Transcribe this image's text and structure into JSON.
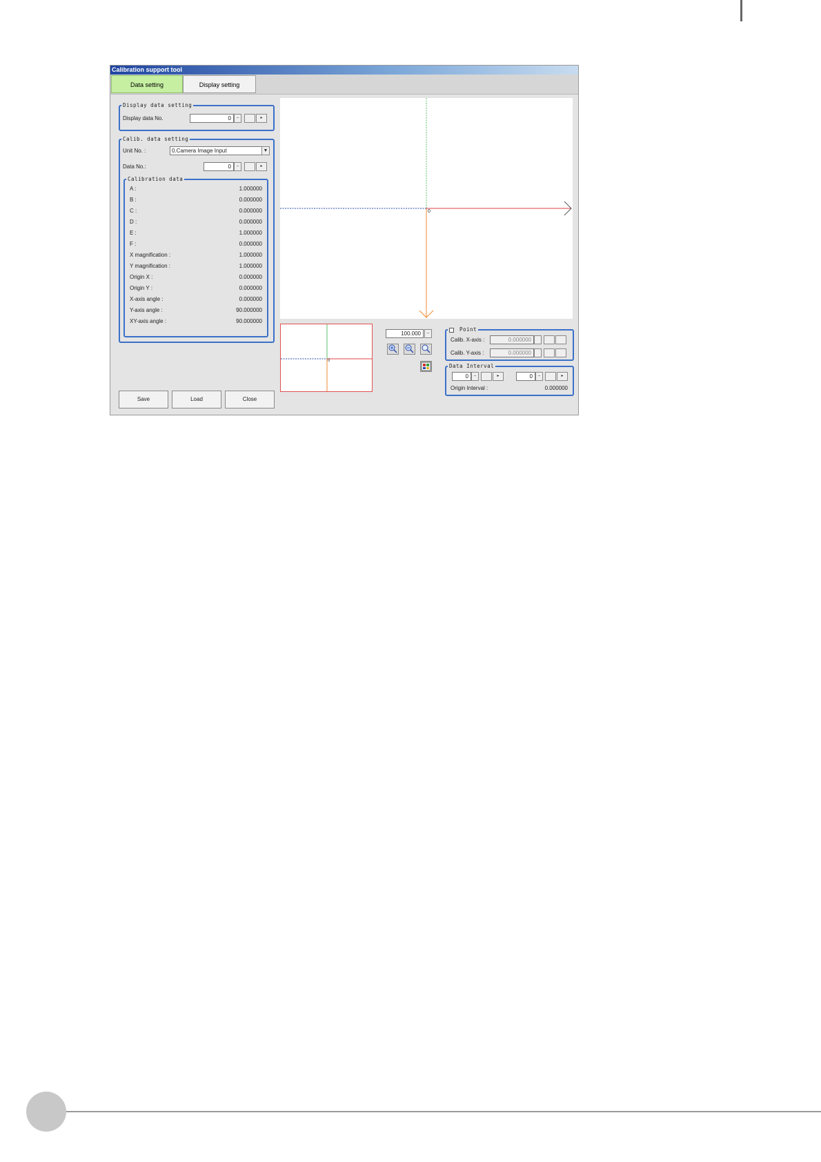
{
  "window": {
    "title": "Calibration support tool"
  },
  "tabs": [
    {
      "label": "Data setting",
      "active": true
    },
    {
      "label": "Display setting",
      "active": false
    }
  ],
  "display_data_setting": {
    "legend": "Display data setting",
    "label": "Display data No.",
    "value": "0",
    "minus": "–",
    "next": "▸"
  },
  "calib_data_setting": {
    "legend": "Calib. data setting",
    "unit_label": "Unit No. :",
    "unit_value": "0.Camera Image Input",
    "data_no_label": "Data No.:",
    "data_no_value": "0",
    "minus": "–",
    "next": "▸"
  },
  "calibration_data": {
    "legend": "Calibration data",
    "rows": [
      {
        "label": "A :",
        "value": "1.000000"
      },
      {
        "label": "B :",
        "value": "0.000000"
      },
      {
        "label": "C :",
        "value": "0.000000"
      },
      {
        "label": "D :",
        "value": "0.000000"
      },
      {
        "label": "E :",
        "value": "1.000000"
      },
      {
        "label": "F :",
        "value": "0.000000"
      },
      {
        "label": "X magnification :",
        "value": "1.000000"
      },
      {
        "label": "Y magnification :",
        "value": "1.000000"
      },
      {
        "label": "Origin X :",
        "value": "0.000000"
      },
      {
        "label": "Origin Y :",
        "value": "0.000000"
      },
      {
        "label": "X-axis angle :",
        "value": "0.000000"
      },
      {
        "label": "Y-axis angle :",
        "value": "90.000000"
      },
      {
        "label": "XY-axis angle :",
        "value": "90.000000"
      }
    ]
  },
  "buttons": {
    "save": "Save",
    "load": "Load",
    "close": "Close"
  },
  "main_view": {
    "origin_label": "0"
  },
  "mini_view": {
    "origin_label": "0"
  },
  "zoom": {
    "value": "100.000",
    "minus": "–"
  },
  "point": {
    "legend": "Point",
    "calib_x_label": "Calib. X-axis :",
    "calib_x_value": "0.000000",
    "calib_y_label": "Calib. Y-axis :",
    "calib_y_value": "0.000000"
  },
  "data_interval": {
    "legend": "Data Interval",
    "left_value": "0",
    "right_value": "0",
    "minus": "–",
    "next": "▸",
    "origin_interval_label": "Origin Interval :",
    "origin_interval_value": "0.000000"
  },
  "icons": [
    "zoom-in-icon",
    "zoom-out-icon",
    "zoom-fit-icon",
    "display-image-icon"
  ],
  "colors": {
    "group_border": "#3a70c8",
    "active_tab": "#c6efa2",
    "x_axis": "#e04040",
    "y_axis": "#f08a30",
    "grid_green": "#5cc06a",
    "grid_blue": "#2a4aa8"
  }
}
